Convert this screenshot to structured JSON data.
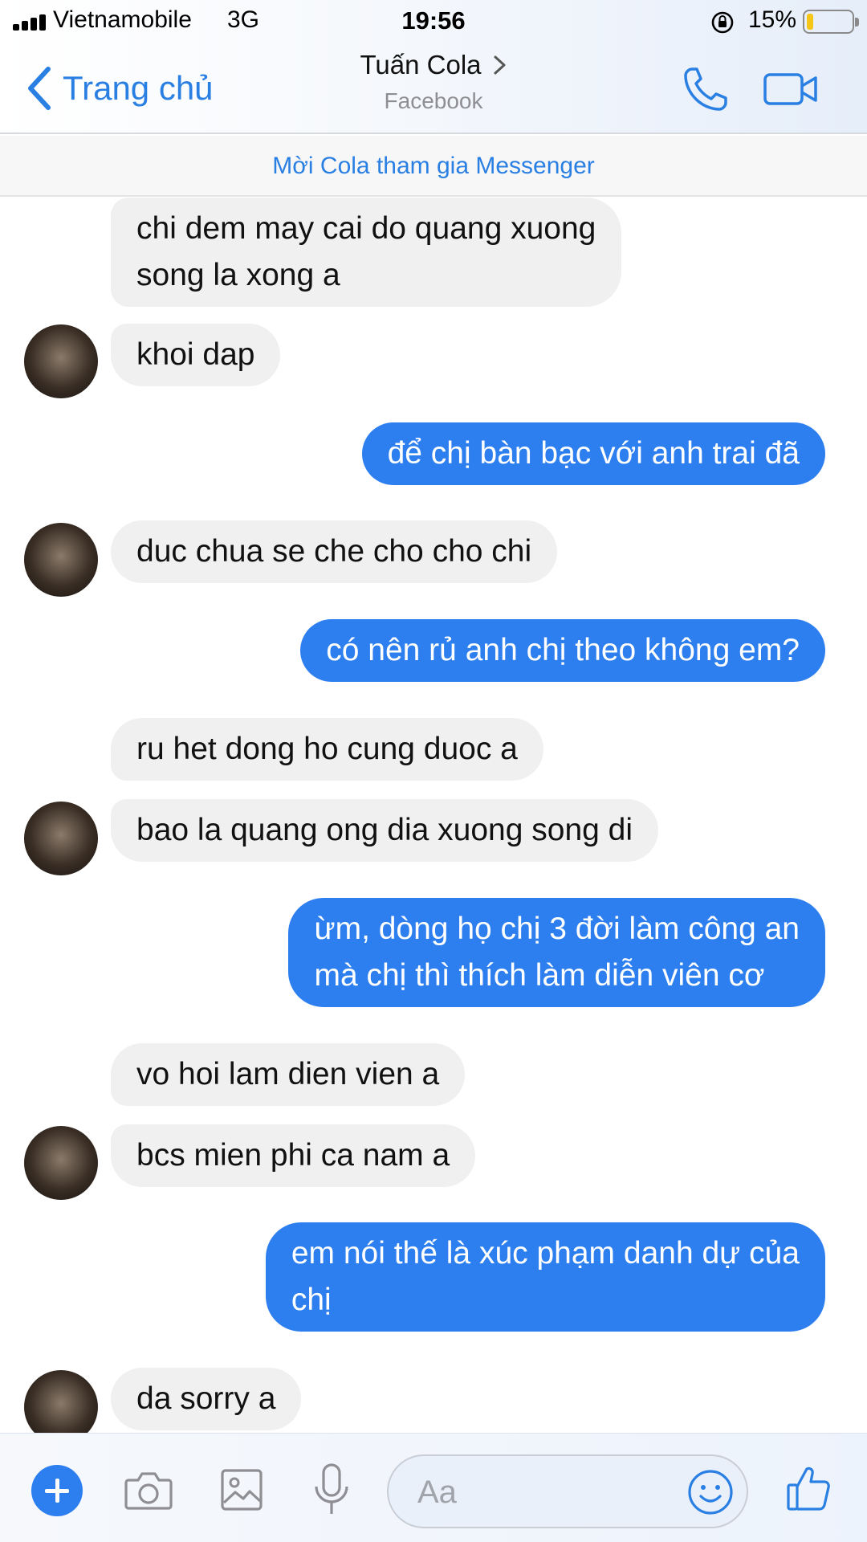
{
  "status_bar": {
    "carrier": "Vietnamobile",
    "network": "3G",
    "time": "19:56",
    "battery_percent": "15%",
    "battery_level": 0.15
  },
  "nav": {
    "back_label": "Trang chủ",
    "contact_name": "Tuấn Cola",
    "contact_subtitle": "Facebook",
    "accent_color": "#2a7fe3"
  },
  "invite_banner": "Mời Cola tham gia Messenger",
  "messages": [
    {
      "side": "in",
      "text_lines": [
        "chi dem may cai do quang xuong",
        "song la xong a"
      ]
    },
    {
      "side": "in",
      "text_lines": [
        "khoi dap"
      ],
      "avatar": true
    },
    {
      "side": "out",
      "text_lines": [
        "để chị bàn bạc với anh trai đã"
      ]
    },
    {
      "side": "in",
      "text_lines": [
        "duc chua se che cho cho chi"
      ],
      "avatar": true
    },
    {
      "side": "out",
      "text_lines": [
        "có nên rủ anh chị theo không em?"
      ]
    },
    {
      "side": "in",
      "text_lines": [
        "ru het dong ho cung duoc a"
      ]
    },
    {
      "side": "in",
      "text_lines": [
        "bao la quang ong dia xuong song di"
      ],
      "avatar": true
    },
    {
      "side": "out",
      "text_lines": [
        "ừm, dòng họ chị 3 đời làm công an",
        "mà chị thì thích làm diễn viên cơ"
      ]
    },
    {
      "side": "in",
      "text_lines": [
        "vo hoi lam dien vien a"
      ]
    },
    {
      "side": "in",
      "text_lines": [
        "bcs mien phi ca nam a"
      ],
      "avatar": true
    },
    {
      "side": "out",
      "text_lines": [
        "em nói thế là xúc phạm danh dự của",
        "chị"
      ]
    },
    {
      "side": "in",
      "text_lines": [
        "da sorry a"
      ],
      "avatar": true
    }
  ],
  "composer": {
    "placeholder": "Aa",
    "icons": [
      "plus-icon",
      "camera-icon",
      "image-icon",
      "microphone-icon",
      "emoji-icon",
      "thumbs-up-icon"
    ]
  },
  "colors": {
    "incoming_bubble": "#f0f0f0",
    "outgoing_bubble": "#2d7ff0",
    "link_blue": "#2a7fe3"
  }
}
